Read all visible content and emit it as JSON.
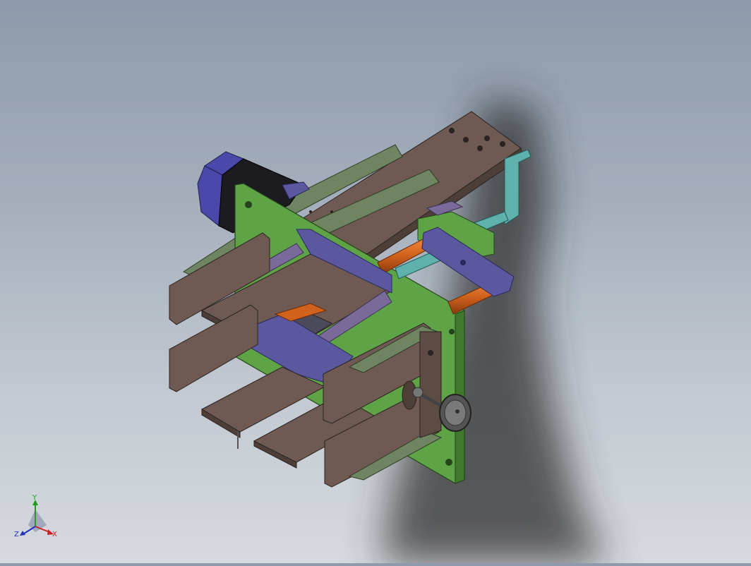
{
  "viewport": {
    "background_top": "#8e9aab",
    "background_bottom": "#d6dadf",
    "model_colors": {
      "plate_brown": "#6e5a52",
      "plate_brown_dark": "#4e3e38",
      "frame_green": "#5fa347",
      "frame_green_dark": "#3f7a2c",
      "olive_gusset": "#6f8460",
      "bracket_blue": "#5c58a0",
      "bracket_blue_dark": "#3d3a78",
      "rod_orange": "#d0621c",
      "teal_bracket": "#5fb2ac",
      "motor_black": "#1b1b20",
      "motor_purple": "#4a48a8",
      "purple_fin": "#7a6a9a"
    }
  },
  "triad": {
    "x_label": "X",
    "y_label": "Y",
    "z_label": "Z",
    "x_color": "#d12020",
    "y_color": "#1e9e1e",
    "z_color": "#2030c0"
  }
}
